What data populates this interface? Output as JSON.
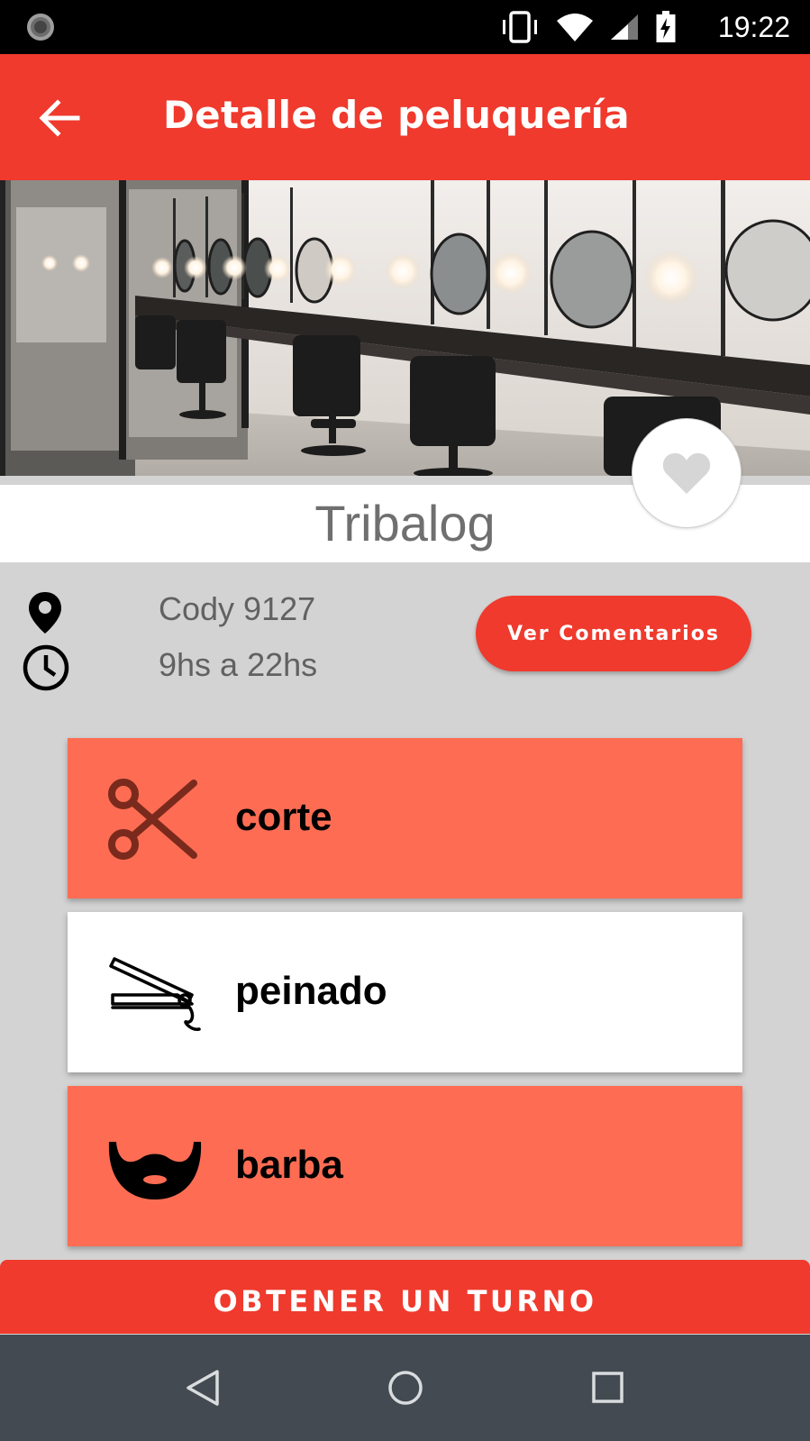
{
  "status_bar": {
    "time": "19:22",
    "icons": [
      "loading-indicator-icon",
      "vibrate-icon",
      "wifi-icon",
      "cell-signal-icon",
      "battery-charging-icon"
    ]
  },
  "app_bar": {
    "title": "Detalle de peluquería",
    "back_icon": "arrow-left-icon"
  },
  "salon": {
    "name": "Tribalog",
    "address": "Cody 9127",
    "hours": "9hs a 22hs",
    "favorite_icon": "heart-icon",
    "reviews_button": "Ver Comentarios"
  },
  "services": [
    {
      "label": "corte",
      "icon": "scissors-icon",
      "style": "accent"
    },
    {
      "label": "peinado",
      "icon": "hair-straightener-icon",
      "style": "plain"
    },
    {
      "label": "barba",
      "icon": "beard-icon",
      "style": "accent"
    }
  ],
  "cta": {
    "label": "OBTENER UN TURNO"
  },
  "nav_bar": {
    "icons": [
      "nav-back-icon",
      "nav-home-icon",
      "nav-recents-icon"
    ]
  },
  "colors": {
    "primary": "#ef3a2d",
    "accent_card": "#fe6d53",
    "background": "#d3d3d3",
    "nav_bar": "#434a51",
    "status_bar": "#000000"
  }
}
